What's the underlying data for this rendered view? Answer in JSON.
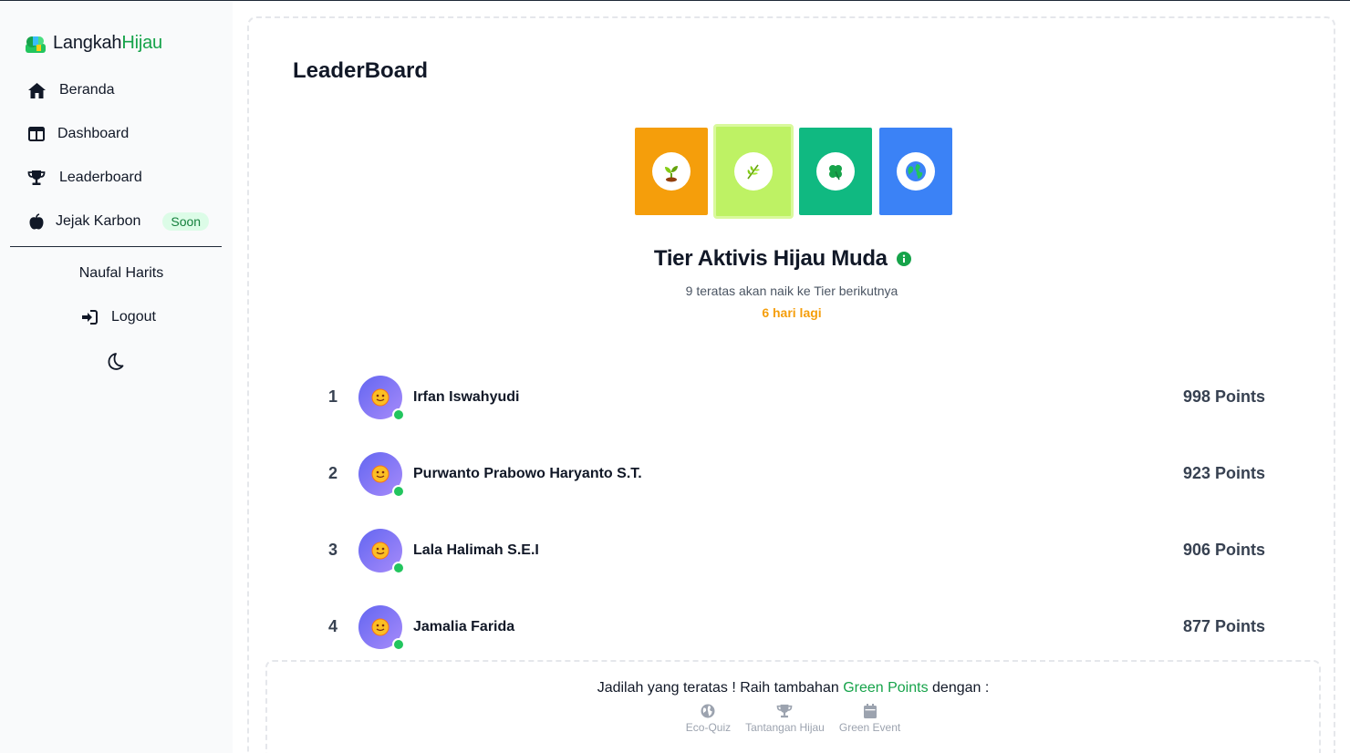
{
  "brand": {
    "part1": "Langkah",
    "part2": "Hijau"
  },
  "sidebar": {
    "items": [
      {
        "label": "Beranda",
        "icon": "home-icon"
      },
      {
        "label": "Dashboard",
        "icon": "columns-icon"
      },
      {
        "label": "Leaderboard",
        "icon": "trophy-icon"
      },
      {
        "label": "Jejak Karbon",
        "icon": "apple-icon",
        "badge": "Soon"
      }
    ],
    "user_name": "Naufal Harits",
    "logout_label": "Logout"
  },
  "main": {
    "title": "LeaderBoard",
    "tiers": [
      {
        "color": "#f59e0b",
        "icon": "seedling-icon"
      },
      {
        "color": "#bef264",
        "icon": "herb-icon",
        "active": true
      },
      {
        "color": "#10b981",
        "icon": "clover-icon"
      },
      {
        "color": "#3b82f6",
        "icon": "globe-icon"
      }
    ],
    "tier_name": "Tier Aktivis Hijau Muda",
    "tier_sub": "9 teratas akan naik ke Tier berikutnya",
    "tier_days": "6 hari lagi",
    "rows": [
      {
        "rank": "1",
        "name": "Irfan Iswahyudi",
        "points": "998 Points"
      },
      {
        "rank": "2",
        "name": "Purwanto Prabowo Haryanto S.T.",
        "points": "923 Points"
      },
      {
        "rank": "3",
        "name": "Lala Halimah S.E.I",
        "points": "906 Points"
      },
      {
        "rank": "4",
        "name": "Jamalia Farida",
        "points": "877 Points"
      }
    ],
    "cta": {
      "text_before": "Jadilah yang teratas ! Raih tambahan ",
      "text_green": "Green Points",
      "text_after": " dengan :",
      "links": [
        {
          "label": "Eco-Quiz",
          "icon": "globe-icon"
        },
        {
          "label": "Tantangan Hijau",
          "icon": "trophy-icon"
        },
        {
          "label": "Green Event",
          "icon": "calendar-icon"
        }
      ]
    }
  }
}
